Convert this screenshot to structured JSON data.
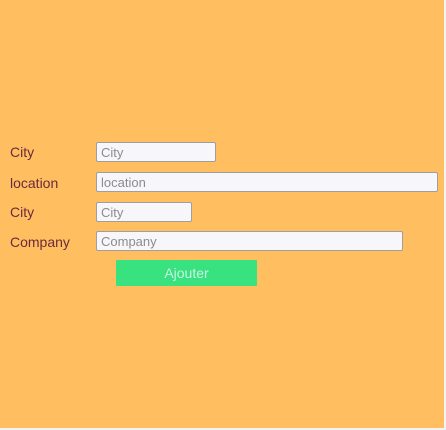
{
  "form": {
    "fields": [
      {
        "label": "City",
        "placeholder": "City",
        "value": ""
      },
      {
        "label": "location",
        "placeholder": "location",
        "value": ""
      },
      {
        "label": "City",
        "placeholder": "City",
        "value": ""
      },
      {
        "label": "Company",
        "placeholder": "Company",
        "value": ""
      }
    ],
    "submit_label": "Ajouter"
  },
  "colors": {
    "background": "#ffbf61",
    "label_text": "#6b2a3b",
    "button_bg": "#38e27e",
    "button_text": "#c9f3e4"
  }
}
